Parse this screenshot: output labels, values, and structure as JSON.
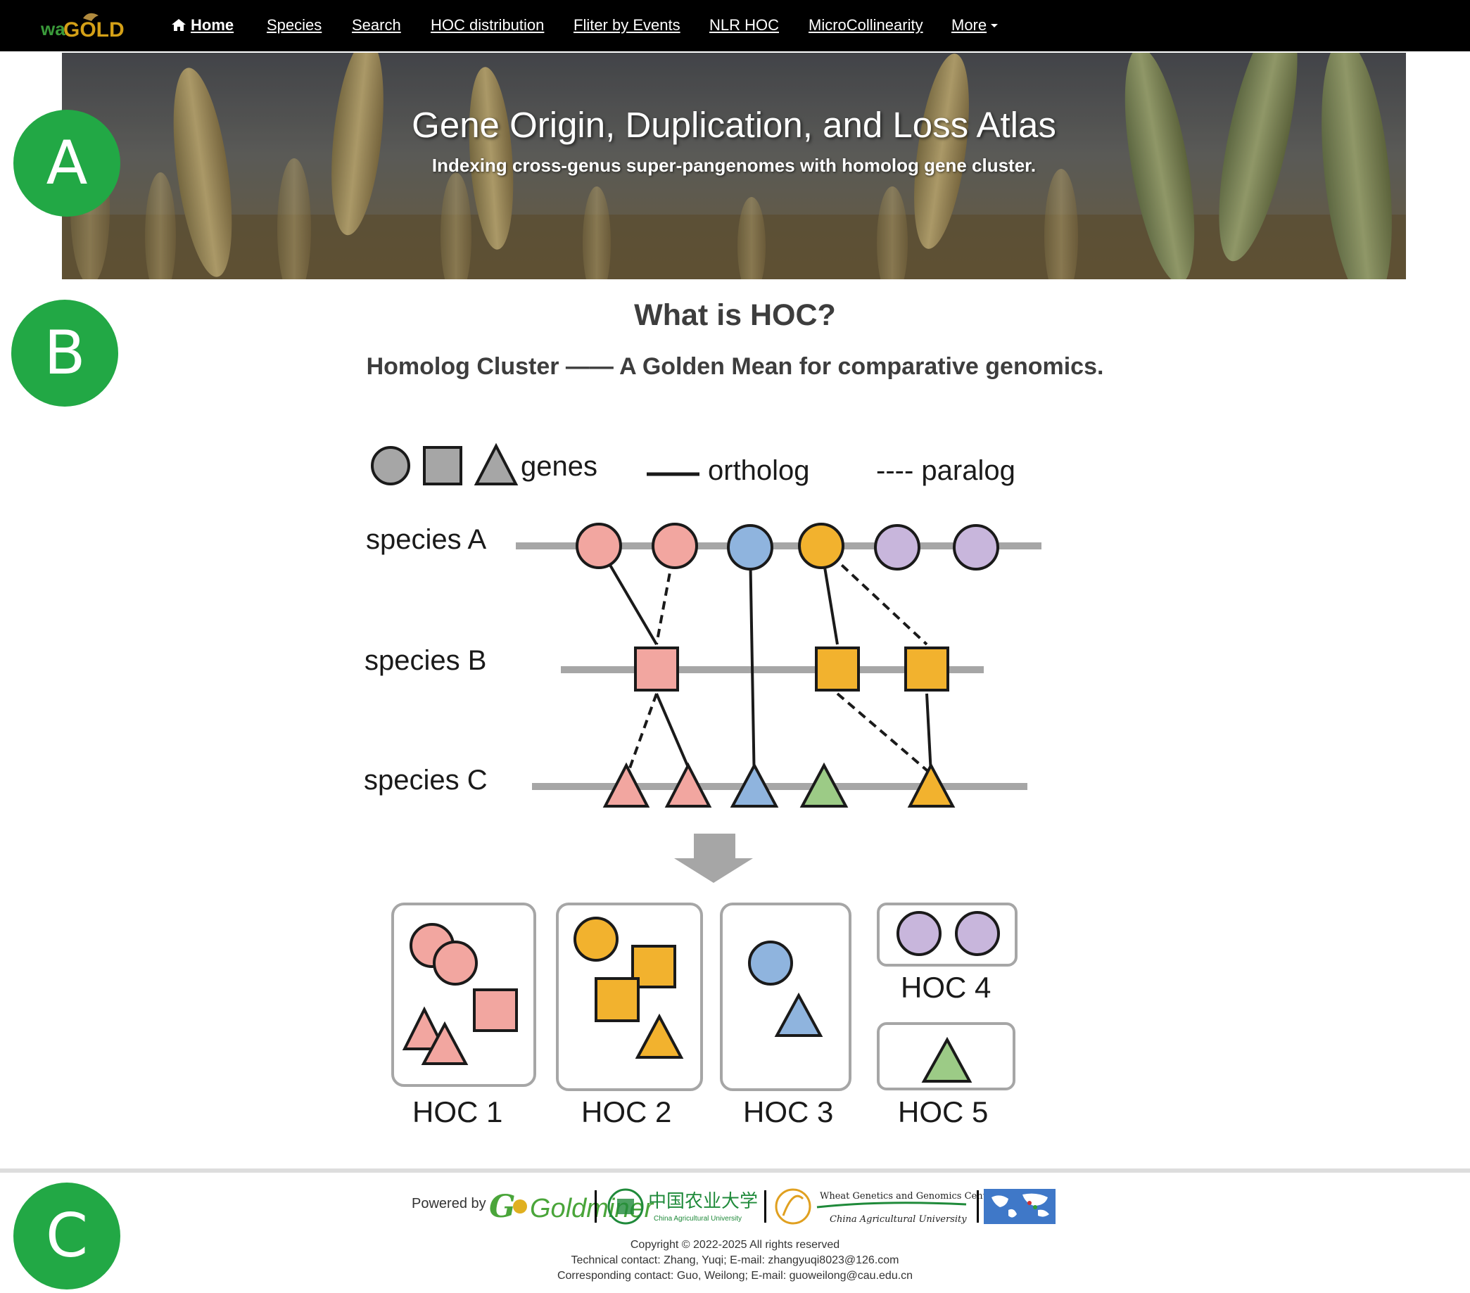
{
  "navbar": {
    "brand": {
      "prefix": "wa",
      "suffix": "GOLD"
    },
    "items": [
      {
        "label": "Home",
        "active": true
      },
      {
        "label": "Species"
      },
      {
        "label": "Search"
      },
      {
        "label": "HOC distribution"
      },
      {
        "label": "Fliter by Events"
      },
      {
        "label": "NLR HOC"
      },
      {
        "label": "MicroCollinearity"
      },
      {
        "label": "More"
      }
    ]
  },
  "badges": {
    "a": "A",
    "b": "B",
    "c": "C"
  },
  "hero": {
    "title": "Gene Origin, Duplication, and Loss Atlas",
    "subtitle": "Indexing cross-genus super-pangenomes with homolog gene cluster."
  },
  "intro": {
    "title": "What is HOC?",
    "subtitle": "Homolog Cluster —— A Golden Mean for comparative genomics."
  },
  "diagram": {
    "legend": {
      "genes": "genes",
      "ortholog": "ortholog",
      "paralog": "---- paralog"
    },
    "species": [
      "species A",
      "species B",
      "species C"
    ],
    "hocs": [
      "HOC 1",
      "HOC 2",
      "HOC 3",
      "HOC 4",
      "HOC 5"
    ],
    "colors": {
      "pink": "#f2a6a0",
      "blue": "#8fb4de",
      "orange": "#f2b22e",
      "purple": "#c8b6dc",
      "green": "#9ccb86",
      "gray": "#a6a6a6"
    }
  },
  "footer": {
    "powered_by": "Powered by",
    "logo_goldminer": "Goldminer",
    "logo_cau_cn": "中国农业大学",
    "logo_cau_en": "China Agricultural University",
    "logo_wggc_top": "Wheat Genetics and Genomics Center",
    "logo_wggc_bottom": "China Agricultural University",
    "copyright": "Copyright © 2022-2025 All rights reserved",
    "technical": "Technical contact: Zhang, Yuqi; E-mail: zhangyuqi8023@126.com",
    "corresponding": "Corresponding contact: Guo, Weilong; E-mail: guoweilong@cau.edu.cn"
  }
}
